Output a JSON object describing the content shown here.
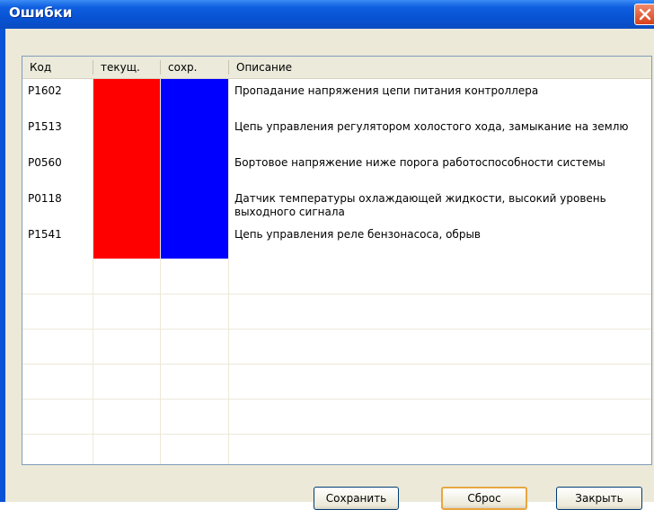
{
  "window": {
    "title": "Ошибки"
  },
  "table": {
    "columns": [
      "Код",
      "текущ.",
      "сохр.",
      "Описание"
    ],
    "rows": [
      {
        "code": "P1602",
        "current_color": "#ff0000",
        "saved_color": "#0000ff",
        "description": "Пропадание напряжения цепи питания контроллера"
      },
      {
        "code": "P1513",
        "current_color": "#ff0000",
        "saved_color": "#0000ff",
        "description": "Цепь управления регулятором холостого хода, замыкание на землю"
      },
      {
        "code": "P0560",
        "current_color": "#ff0000",
        "saved_color": "#0000ff",
        "description": "Бортовое напряжение ниже порога работоспособности системы"
      },
      {
        "code": "P0118",
        "current_color": "#ff0000",
        "saved_color": "#0000ff",
        "description": "Датчик температуры охлаждающей жидкости, высокий уровень выходного сигнала"
      },
      {
        "code": "P1541",
        "current_color": "#ff0000",
        "saved_color": "#0000ff",
        "description": "Цепь управления реле бензонасоса, обрыв"
      }
    ]
  },
  "buttons": {
    "save": "Сохранить",
    "reset": "Сброс",
    "close": "Закрыть"
  },
  "icons": {
    "close": "close-icon"
  }
}
